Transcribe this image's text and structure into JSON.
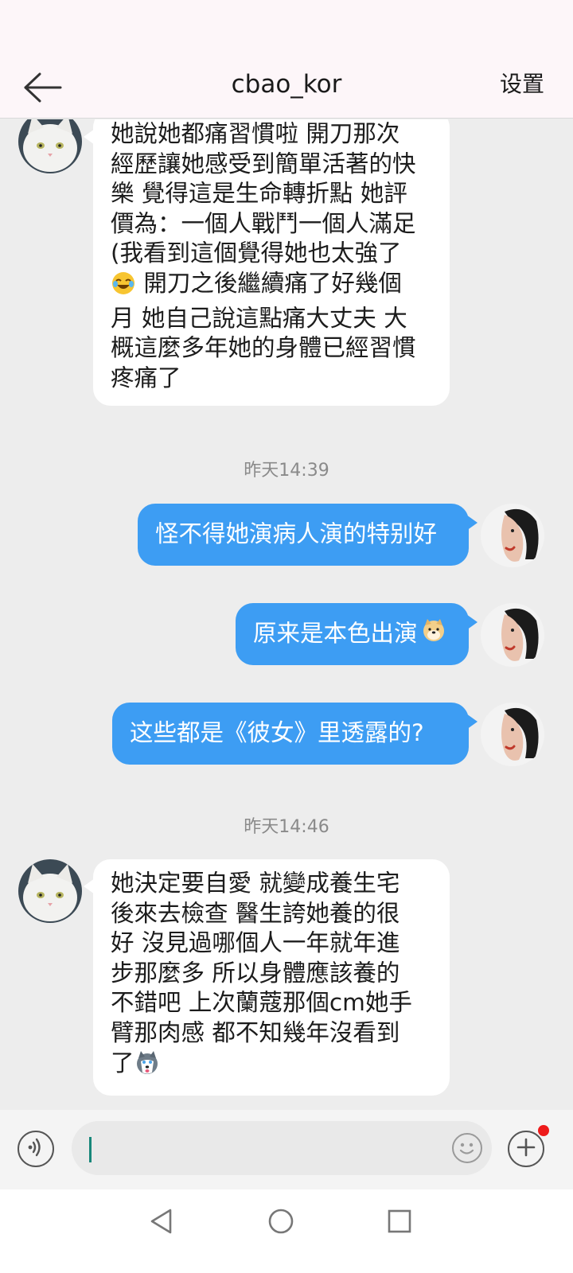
{
  "header": {
    "title": "cbao_kor",
    "settings_label": "设置"
  },
  "messages": [
    {
      "direction": "incoming",
      "lines": [
        "她說她都痛習慣啦  開刀那次",
        "經歷讓她感受到簡單活著的快",
        "樂 覺得這是生命轉折點  她評",
        "價為：一個人戰鬥一個人滿足",
        "(我看到這個覺得她也太強了",
        " 開刀之後繼續痛了好幾個",
        "月 她自己說這點痛大丈夫  大",
        "概這麼多年她的身體已經習慣",
        "疼痛了"
      ],
      "emoji": "laughing-crying-emoji"
    },
    {
      "timestamp": "昨天14:39"
    },
    {
      "direction": "outgoing",
      "text": "怪不得她演病人演的特别好"
    },
    {
      "direction": "outgoing",
      "text": "原来是本色出演",
      "emoji": "doge-emoji"
    },
    {
      "direction": "outgoing",
      "text": "这些都是《彼女》里透露的?"
    },
    {
      "timestamp": "昨天14:46"
    },
    {
      "direction": "incoming",
      "lines": [
        "她決定要自愛 就變成養生宅",
        "後來去檢查 醫生誇她養的很",
        "好 沒見過哪個人一年就年進",
        "步那麼多 所以身體應該養的",
        "不錯吧  上次蘭蔻那個cm她手",
        "臂那肉感 都不知幾年沒看到",
        "了"
      ],
      "emoji": "husky-emoji"
    }
  ],
  "input": {
    "value": "",
    "placeholder": ""
  },
  "icons": {
    "back": "back-arrow-icon",
    "voice": "voice-icon",
    "emoji_picker": "smiley-icon",
    "more": "plus-icon",
    "nav_back": "nav-back-icon",
    "nav_home": "nav-home-icon",
    "nav_recents": "nav-recents-icon"
  },
  "colors": {
    "outgoing_bubble": "#3d9df3",
    "incoming_bubble": "#ffffff",
    "chat_background": "#ededed",
    "header_background": "#fdf6f9",
    "notification_dot": "#ee1b1b",
    "caret": "#17877a"
  }
}
